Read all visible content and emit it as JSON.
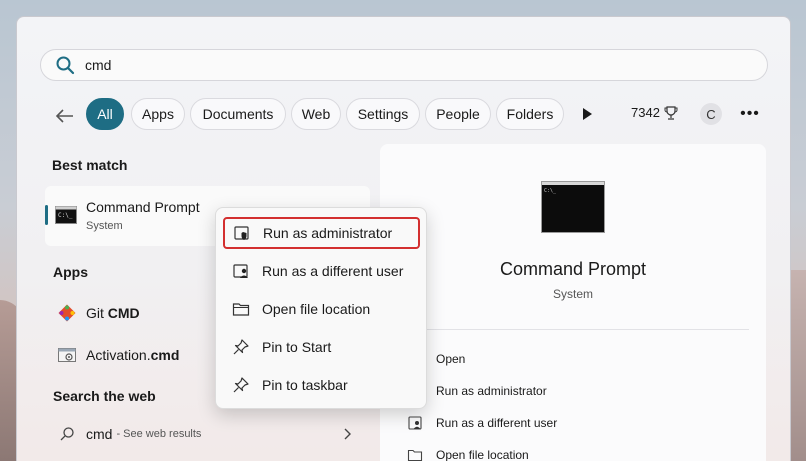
{
  "search": {
    "value": "cmd",
    "icon": "search-icon"
  },
  "filters": {
    "chips": [
      {
        "label": "All",
        "active": true
      },
      {
        "label": "Apps"
      },
      {
        "label": "Documents"
      },
      {
        "label": "Web"
      },
      {
        "label": "Settings"
      },
      {
        "label": "People"
      },
      {
        "label": "Folders"
      }
    ],
    "points": "7342",
    "avatar": "C",
    "more": "•••"
  },
  "best_match": {
    "heading": "Best match",
    "name": "Command Prompt",
    "sub": "System"
  },
  "apps": {
    "heading": "Apps",
    "items": [
      {
        "prefix": "Git ",
        "bold": "CMD",
        "suffix": ""
      },
      {
        "prefix": "Activation.",
        "bold": "cmd",
        "suffix": ""
      }
    ]
  },
  "web": {
    "heading": "Search the web",
    "query": "cmd",
    "hint": "- See web results"
  },
  "preview": {
    "title": "Command Prompt",
    "subtitle": "System",
    "actions": [
      "Open",
      "Run as administrator",
      "Run as a different user",
      "Open file location"
    ]
  },
  "context_menu": {
    "items": [
      "Run as administrator",
      "Run as a different user",
      "Open file location",
      "Pin to Start",
      "Pin to taskbar"
    ]
  },
  "colors": {
    "accent": "#1e6d84",
    "highlight_border": "#d32f2f"
  }
}
